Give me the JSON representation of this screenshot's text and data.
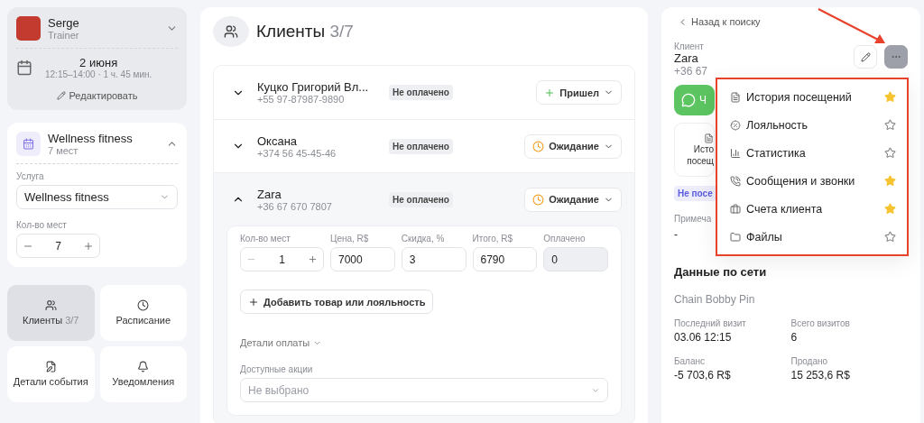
{
  "trainer": {
    "name": "Serge",
    "role": "Trainer",
    "date": "2 июня",
    "time": "12:15–14:00 · 1 ч. 45 мин.",
    "edit": "Редактировать",
    "expanded": false
  },
  "event": {
    "title": "Wellness fitness",
    "places": "7 мест",
    "expanded": true,
    "service_label": "Услуга",
    "service": "Wellness fitness",
    "count_label": "Кол-во мест",
    "count": "7"
  },
  "nav": [
    {
      "label": "Клиенты",
      "count": "3/7",
      "selected": true
    },
    {
      "label": "Расписание",
      "selected": false
    },
    {
      "label": "Детали события",
      "selected": false
    },
    {
      "label": "Уведомления",
      "selected": false
    }
  ],
  "clients": {
    "title": "Клиенты",
    "count": "3/7",
    "rows": [
      {
        "name": "Куцко Григорий Вл...",
        "phone": "+55 97-87987-9890",
        "badge": "Не оплачено",
        "status": {
          "kind": "arrived",
          "label": "Пришел"
        },
        "expanded": false
      },
      {
        "name": "Оксана",
        "phone": "+374 56 45-45-46",
        "badge": "Не оплачено",
        "status": {
          "kind": "waiting",
          "label": "Ожидание"
        },
        "expanded": false
      },
      {
        "name": "Zara",
        "phone": "+36 67 670 7807",
        "badge": "Не оплачено",
        "status": {
          "kind": "waiting",
          "label": "Ожидание"
        },
        "expanded": true
      }
    ],
    "details": {
      "fields": [
        {
          "kind": "stepper",
          "label": "Кол-во мест",
          "value": "1",
          "disabled": false
        },
        {
          "kind": "input",
          "label": "Цена, R$",
          "value": "7000",
          "disabled": false
        },
        {
          "kind": "input",
          "label": "Скидка, %",
          "value": "3",
          "disabled": false
        },
        {
          "kind": "input",
          "label": "Итого, R$",
          "value": "6790",
          "disabled": false
        },
        {
          "kind": "input",
          "label": "Оплачено",
          "value": "0",
          "disabled": true
        }
      ],
      "add_button": "Добавить товар или лояльность",
      "payment_details": "Детали оплаты",
      "promo_label": "Доступные акции",
      "promo_placeholder": "Не выбрано"
    }
  },
  "client_card": {
    "back": "Назад к поиску",
    "label": "Клиент",
    "name": "Zara",
    "phone": "+36 67",
    "chat_button": "Ч",
    "history_tile": [
      "Исто",
      "посещ"
    ],
    "visit_badge": "Не посе",
    "note_label": "Примеча",
    "note": "-",
    "network_title": "Данные по сети",
    "network": "Chain Bobby Pin",
    "stats": [
      {
        "label": "Последний визит",
        "value": "03.06 12:15"
      },
      {
        "label": "Всего визитов",
        "value": "6"
      },
      {
        "label": "Баланс",
        "value": "-5 703,6 R$"
      },
      {
        "label": "Продано",
        "value": "15 253,6 R$"
      }
    ]
  },
  "menu": [
    {
      "label": "История посещений",
      "starred": true
    },
    {
      "label": "Лояльность",
      "starred": false
    },
    {
      "label": "Статистика",
      "starred": false
    },
    {
      "label": "Сообщения и звонки",
      "starred": true
    },
    {
      "label": "Счета клиента",
      "starred": true
    },
    {
      "label": "Файлы",
      "starred": false
    }
  ]
}
